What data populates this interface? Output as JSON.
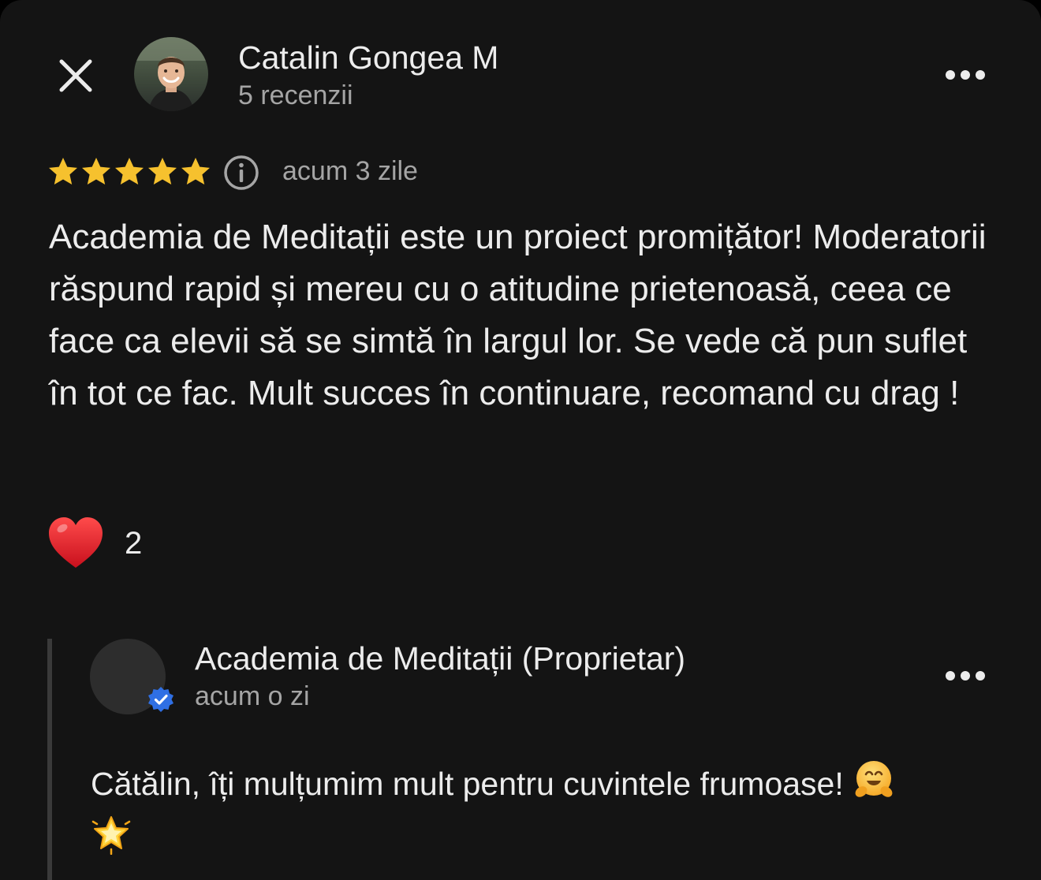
{
  "review": {
    "author_name": "Catalin Gongea M",
    "author_meta": "5 recenzii",
    "rating": 5,
    "rating_max": 5,
    "date": "acum 3 zile",
    "text": "Academia de Meditații este un proiect promițător! Moderatorii răspund rapid și mereu cu o atitudine prietenoasă, ceea ce face ca elevii să se simtă în largul lor. Se vede că pun suflet în tot ce fac. Mult succes în continuare, recomand cu drag !",
    "reaction_count": "2"
  },
  "reply": {
    "owner_name": "Academia de Meditații (Proprietar)",
    "date": "acum o zi",
    "text": "Cătălin, îți mulțumim mult pentru cuvintele frumoase!"
  },
  "icons": {
    "close": "close-icon",
    "more": "more-horizontal-icon",
    "star": "star-icon",
    "info": "info-icon",
    "heart": "heart-icon",
    "verified": "verified-check-icon",
    "hug_emoji": "hugging-face-emoji",
    "star_emoji": "glowing-star-emoji"
  },
  "colors": {
    "background": "#141414",
    "text_primary": "#ececec",
    "text_secondary": "#a5a5a5",
    "star": "#f6c12e",
    "heart": "#e5202e",
    "verified": "#2f6fe4"
  }
}
